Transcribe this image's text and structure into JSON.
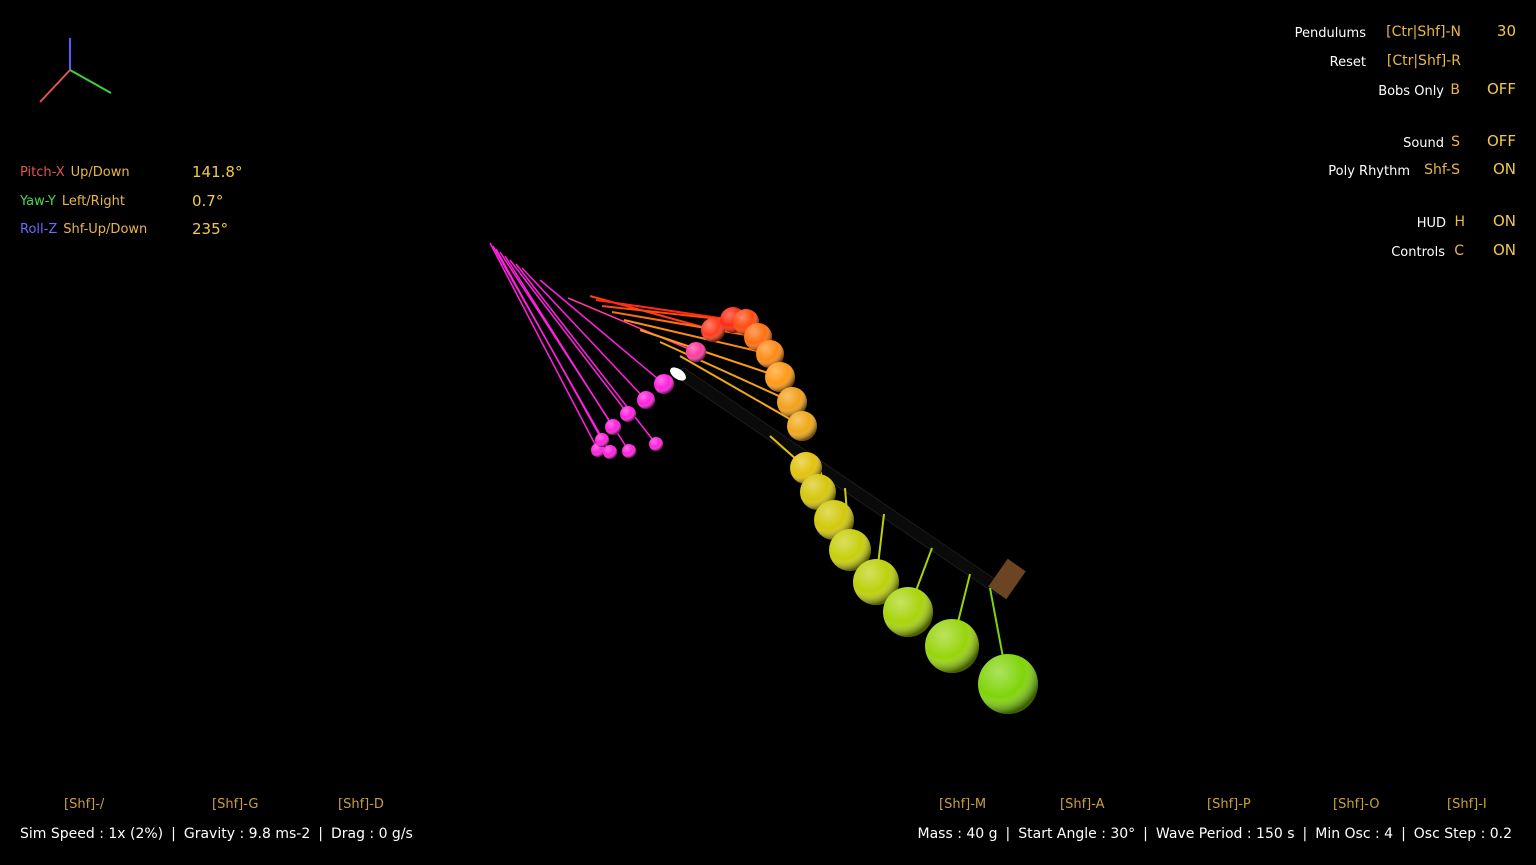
{
  "orientation": {
    "pitch": {
      "axis": "Pitch-X",
      "keys": "Up/Down",
      "value": "141.8°",
      "color": "#e0554f"
    },
    "yaw": {
      "axis": "Yaw-Y",
      "keys": "Left/Right",
      "value": "0.7°",
      "color": "#4fd64f"
    },
    "roll": {
      "axis": "Roll-Z",
      "keys": "Shf-Up/Down",
      "value": "235°",
      "color": "#6a6aff"
    }
  },
  "controls": {
    "pendulums": {
      "label": "Pendulums",
      "key": "[Ctr|Shf]-N",
      "state": "30"
    },
    "reset": {
      "label": "Reset",
      "key": "[Ctr|Shf]-R",
      "state": ""
    },
    "bobs_only": {
      "label": "Bobs Only",
      "key": "B",
      "state": "OFF"
    },
    "sound": {
      "label": "Sound",
      "key": "S",
      "state": "OFF"
    },
    "poly_rhythm": {
      "label": "Poly Rhythm",
      "key": "Shf-S",
      "state": "ON"
    },
    "hud": {
      "label": "HUD",
      "key": "H",
      "state": "ON"
    },
    "controls": {
      "label": "Controls",
      "key": "C",
      "state": "ON"
    }
  },
  "hints": {
    "sim_speed": "[Shf]-/",
    "gravity": "[Shf]-G",
    "drag": "[Shf]-D",
    "mass": "[Shf]-M",
    "start_angle": "[Shf]-A",
    "wave_period": "[Shf]-P",
    "min_osc": "[Shf]-O",
    "osc_step": "[Shf]-I"
  },
  "status_left": {
    "sim_speed": "Sim Speed : 1x (2%)",
    "gravity": "Gravity : 9.8 ms-2",
    "drag": "Drag : 0 g/s"
  },
  "status_right": {
    "mass": "Mass : 40 g",
    "start_angle": "Start Angle : 30°",
    "wave_period": "Wave Period : 150 s",
    "min_osc": "Min Osc : 4",
    "osc_step": "Osc Step : 0.2"
  },
  "colors": {
    "accent_key": "#e8b64a",
    "value": "#f2c94c",
    "background": "#000000",
    "pendulum_gradient": [
      "#ff00ff",
      "#ff2020",
      "#ff8c1a",
      "#d4d10a",
      "#7fd40a"
    ],
    "frame": "#6b4423"
  },
  "icons": {
    "axis_gizmo": "axis-gizmo-icon"
  }
}
